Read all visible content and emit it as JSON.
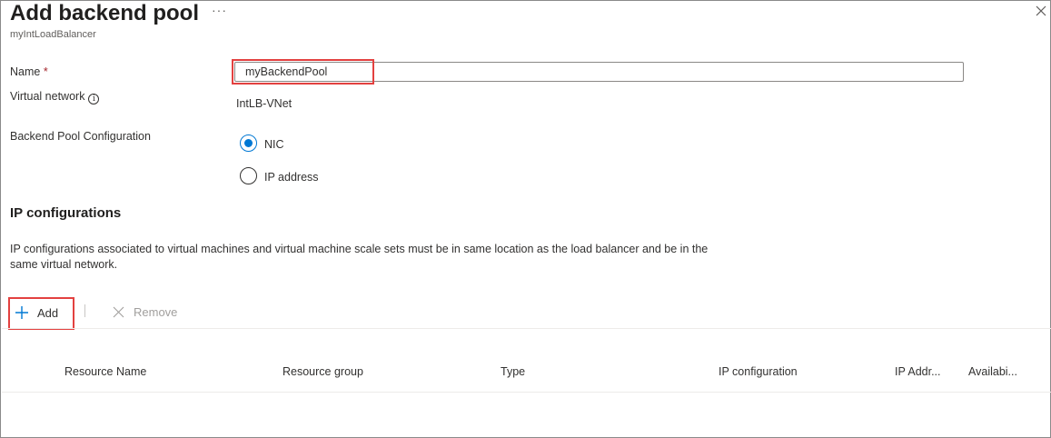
{
  "header": {
    "title": "Add backend pool",
    "more_label": "···",
    "subtitle": "myIntLoadBalancer"
  },
  "form": {
    "name_label": "Name",
    "name_required": "*",
    "name_value": "myBackendPool",
    "vnet_label": "Virtual network",
    "vnet_value": "IntLB-VNet",
    "config_label": "Backend Pool Configuration",
    "options": [
      {
        "label": "NIC",
        "selected": true
      },
      {
        "label": "IP address",
        "selected": false
      }
    ]
  },
  "ip_config": {
    "heading": "IP configurations",
    "description": "IP configurations associated to virtual machines and virtual machine scale sets must be in same location as the load balancer and be in the same virtual network."
  },
  "toolbar": {
    "add_label": "Add",
    "remove_label": "Remove"
  },
  "table": {
    "columns": [
      "Resource Name",
      "Resource group",
      "Type",
      "IP configuration",
      "IP Addr...",
      "Availabi..."
    ]
  },
  "colors": {
    "accent": "#0078d4",
    "highlight": "#e34140"
  }
}
